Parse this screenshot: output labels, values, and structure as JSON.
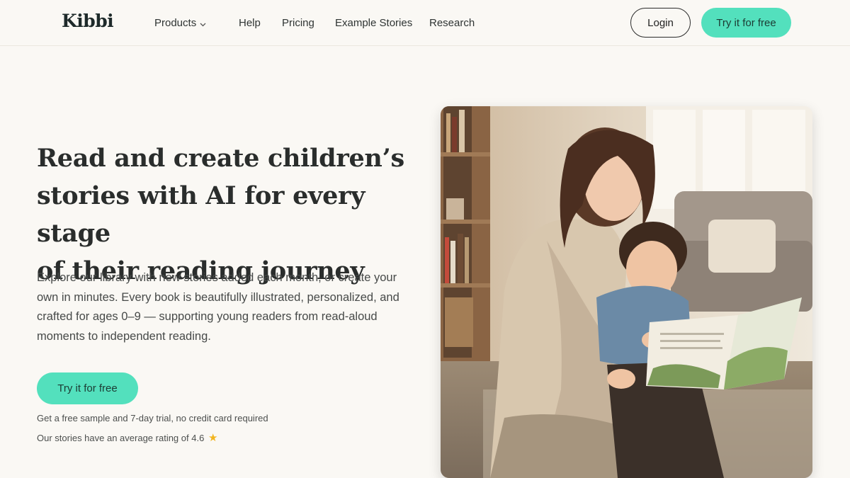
{
  "header": {
    "logo": "Kibbi",
    "nav": [
      {
        "label": "Products",
        "has_dropdown": true
      },
      {
        "label": "Help"
      },
      {
        "label": "Pricing"
      },
      {
        "label": "Example Stories"
      },
      {
        "label": "Research"
      }
    ],
    "login_label": "Login",
    "cta_label": "Try it for free"
  },
  "hero": {
    "title_lines": [
      "Read and create children’s",
      "stories with AI for every stage",
      "of their reading journey"
    ],
    "description_lines": [
      "Explore our library with new stories added each month, or create your",
      "own in minutes. Every book is beautifully illustrated, personalized, and",
      "crafted for ages 0–9 — supporting young readers from read-aloud",
      "moments to independent reading."
    ],
    "cta_label": "Try it for free",
    "note_trial": "Get a free sample and 7-day trial, no credit card required",
    "note_rating": "Our stories have an average rating of 4.6",
    "rating_icon": "star-icon"
  },
  "colors": {
    "background": "#faf8f4",
    "accent": "#53e0bd",
    "text": "#2a2d2c",
    "star": "#f2b51f"
  }
}
